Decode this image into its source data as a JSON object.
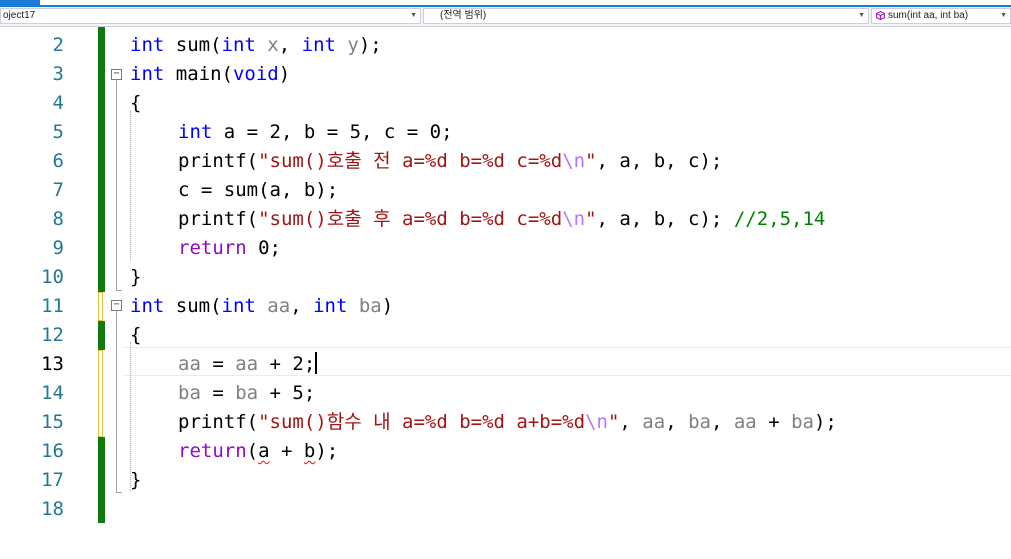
{
  "nav": {
    "project": "oject17",
    "scope": "(전역 범위)",
    "member": "sum(int aa, int ba)"
  },
  "line_numbers": [
    "2",
    "3",
    "4",
    "5",
    "6",
    "7",
    "8",
    "9",
    "10",
    "11",
    "12",
    "13",
    "14",
    "15",
    "16",
    "17",
    "18"
  ],
  "current_line": "13",
  "code": {
    "l2": {
      "kw1": "int",
      "t1": " sum(",
      "kw2": "int",
      "p1": " x",
      "t2": ", ",
      "kw3": "int",
      "p2": " y",
      "t3": ");"
    },
    "l3": {
      "kw1": "int",
      "t1": " main(",
      "kw2": "void",
      "t2": ")"
    },
    "l4": {
      "t1": "{"
    },
    "l5": {
      "kw1": "int",
      "t1": " a = 2, b = 5, c = 0;"
    },
    "l6": {
      "t1": "printf(",
      "s1": "\"sum()호출 전 a=%d b=%d c=%d",
      "e1": "\\n",
      "s2": "\"",
      "t2": ", a, b, c);"
    },
    "l7": {
      "t1": "c = sum(a, b);"
    },
    "l8": {
      "t1": "printf(",
      "s1": "\"sum()호출 후 a=%d b=%d c=%d",
      "e1": "\\n",
      "s2": "\"",
      "t2": ", a, b, c); ",
      "c1": "//2,5,14"
    },
    "l9": {
      "k1": "return",
      "t1": " 0;"
    },
    "l10": {
      "t1": "}"
    },
    "l11": {
      "kw1": "int",
      "t1": " sum(",
      "kw2": "int",
      "p1": " aa",
      "t2": ", ",
      "kw3": "int",
      "p2": " ba",
      "t3": ")"
    },
    "l12": {
      "t1": "{"
    },
    "l13": {
      "p1": "aa",
      "t1": " = ",
      "p2": "aa",
      "t2": " + 2;"
    },
    "l14": {
      "p1": "ba",
      "t1": " = ",
      "p2": "ba",
      "t2": " + 5;"
    },
    "l15": {
      "t1": "printf(",
      "s1": "\"sum()함수 내 a=%d b=%d a+b=%d",
      "e1": "\\n",
      "s2": "\"",
      "t2": ", ",
      "p1": "aa",
      "t3": ", ",
      "p2": "ba",
      "t4": ", ",
      "p3": "aa",
      "t5": " + ",
      "p4": "ba",
      "t6": ");"
    },
    "l16": {
      "k1": "return",
      "t1": "(",
      "u1": "a",
      "t2": " + ",
      "u2": "b",
      "t3": ");"
    },
    "l17": {
      "t1": "}"
    }
  },
  "colors": {
    "keyword": "#0000ff",
    "control": "#8f08c4",
    "string": "#a31515",
    "escape": "#b776fb",
    "parameter": "#808080",
    "comment": "#008000",
    "line_number": "#237893",
    "saved_change_bar": "#107c10",
    "unsaved_change_bar": "#e2c03b",
    "error_squiggle": "#e51400"
  }
}
